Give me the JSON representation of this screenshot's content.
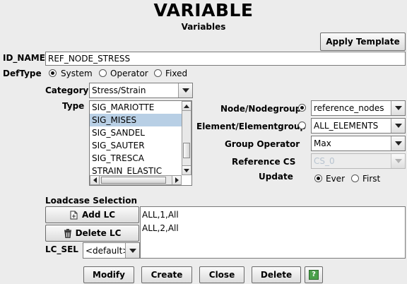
{
  "header": {
    "title": "VARIABLE",
    "subtitle": "Variables"
  },
  "apply_template_label": "Apply Template",
  "id_name": {
    "label": "ID_NAME",
    "value": "REF_NODE_STRESS"
  },
  "deftype": {
    "label": "DefType",
    "options": [
      {
        "label": "System",
        "selected": true
      },
      {
        "label": "Operator",
        "selected": false
      },
      {
        "label": "Fixed",
        "selected": false
      }
    ]
  },
  "category": {
    "label": "Category",
    "value": "Stress/Strain"
  },
  "type_list": {
    "label": "Type",
    "items": [
      "SIG_MARIOTTE",
      "SIG_MISES",
      "SIG_SANDEL",
      "SIG_SAUTER",
      "SIG_TRESCA",
      "STRAIN_ELASTIC"
    ],
    "selected_index": 1
  },
  "node_nodegroup": {
    "label": "Node/Nodegroup",
    "value": "reference_nodes",
    "selected": true
  },
  "element_group": {
    "label": "Element/Elementgroup",
    "value": "ALL_ELEMENTS",
    "selected": false
  },
  "group_operator": {
    "label": "Group Operator",
    "value": "Max"
  },
  "reference_cs": {
    "label": "Reference CS",
    "value": "CS_0"
  },
  "update": {
    "label": "Update",
    "options": [
      {
        "label": "Ever",
        "selected": true
      },
      {
        "label": "First",
        "selected": false
      }
    ]
  },
  "loadcase": {
    "title": "Loadcase Selection",
    "add_label": "Add LC",
    "delete_label": "Delete LC",
    "lines": [
      "ALL,1,All",
      "ALL,2,All"
    ],
    "lc_sel_label": "LC_SEL",
    "lc_sel_value": "<default>"
  },
  "footer": {
    "modify": "Modify",
    "create": "Create",
    "close": "Close",
    "delete": "Delete",
    "help_glyph": "?"
  },
  "colors": {
    "help_green": "#4aa04a",
    "selection": "#b8cfe5"
  }
}
